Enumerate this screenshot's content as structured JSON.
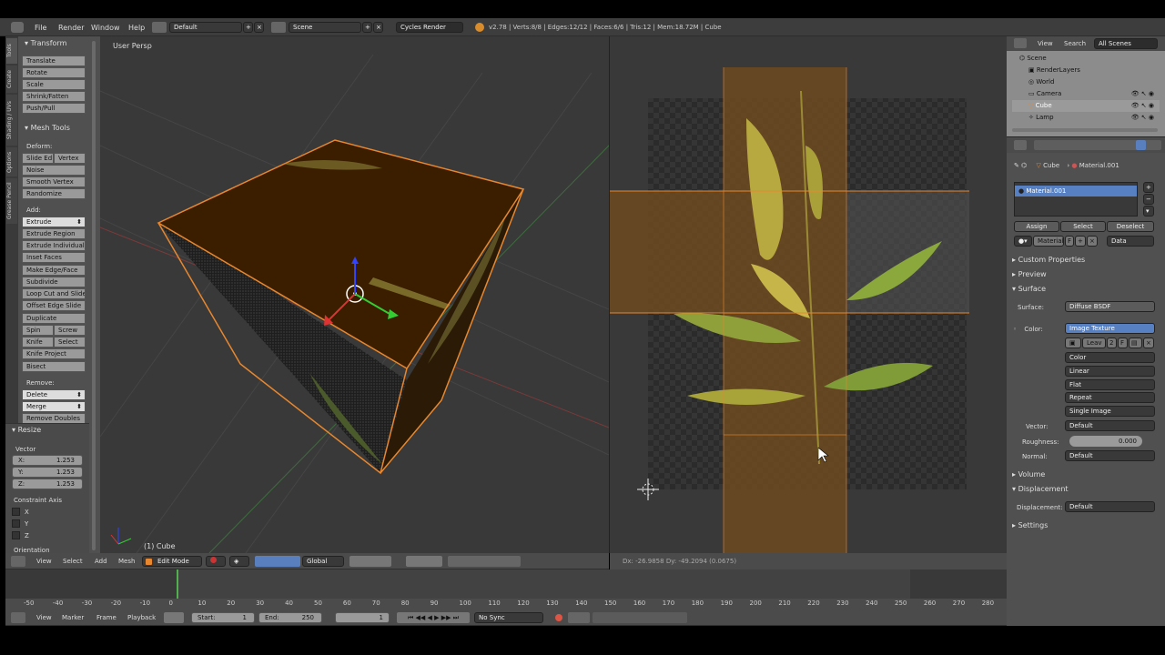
{
  "topbar": {
    "menus": [
      "File",
      "Render",
      "Window",
      "Help"
    ],
    "layout": "Default",
    "scene": "Scene",
    "engine": "Cycles Render",
    "stats": "v2.78 | Verts:8/8 | Edges:12/12 | Faces:6/6 | Tris:12 | Mem:18.72M | Cube"
  },
  "toolshelf": {
    "tabs": [
      "Tools",
      "Create",
      "Shading / UVs",
      "Options",
      "Grease Pencil"
    ],
    "transform_header": "Transform",
    "transform": [
      "Translate",
      "Rotate",
      "Scale",
      "Shrink/Fatten",
      "Push/Pull"
    ],
    "meshtools_header": "Mesh Tools",
    "deform_label": "Deform:",
    "slide_edge": "Slide Ed",
    "vertex": "Vertex",
    "deform": [
      "Noise",
      "Smooth Vertex",
      "Randomize"
    ],
    "add_label": "Add:",
    "extrude": "Extrude",
    "add": [
      "Extrude Region",
      "Extrude Individual",
      "Inset Faces",
      "Make Edge/Face",
      "Subdivide",
      "Loop Cut and Slide",
      "Offset Edge Slide",
      "Duplicate"
    ],
    "spin": "Spin",
    "screw": "Screw",
    "knife": "Knife",
    "select": "Select",
    "knife_project": "Knife Project",
    "bisect": "Bisect",
    "remove_label": "Remove:",
    "delete": "Delete",
    "merge": "Merge",
    "remove_doubles": "Remove Doubles",
    "resize_header": "Resize",
    "vector_label": "Vector",
    "vx": "X:",
    "vy": "Y:",
    "vz": "Z:",
    "vval": "1.253",
    "constraint_label": "Constraint Axis",
    "axes": [
      "X",
      "Y",
      "Z"
    ],
    "orientation_label": "Orientation"
  },
  "viewport": {
    "label": "User Persp",
    "object": "(1) Cube",
    "header": {
      "menus": [
        "View",
        "Select",
        "Add",
        "Mesh"
      ],
      "mode": "Edit Mode",
      "orientation": "Global"
    }
  },
  "uv_editor": {
    "status": "Dx: -26.9858   Dy: -49.2094 (0.0675)"
  },
  "outliner": {
    "menus": [
      "View",
      "Search"
    ],
    "filter": "All Scenes",
    "items": [
      "Scene",
      "RenderLayers",
      "World",
      "Camera",
      "Cube",
      "Lamp"
    ]
  },
  "properties": {
    "crumbs": [
      "Cube",
      "Material.001"
    ],
    "slot": "Material.001",
    "assign": "Assign",
    "select": "Select",
    "deselect": "Deselect",
    "material_name": "Material",
    "f": "F",
    "link": "Data",
    "custom_props": "Custom Properties",
    "preview": "Preview",
    "surface": "Surface",
    "surface_label": "Surface:",
    "surface_val": "Diffuse BSDF",
    "color_label": "Color:",
    "color_val": "Image Texture",
    "image_name": "Leav",
    "image_users": "2",
    "image_f": "F",
    "tex_color": "Color",
    "tex_interp": "Linear",
    "tex_proj": "Flat",
    "tex_ext": "Repeat",
    "tex_source": "Single Image",
    "vector_label": "Vector:",
    "vector_val": "Default",
    "roughness_label": "Roughness:",
    "roughness_val": "0.000",
    "normal_label": "Normal:",
    "normal_val": "Default",
    "volume": "Volume",
    "displacement": "Displacement",
    "disp_label": "Displacement:",
    "disp_val": "Default",
    "settings": "Settings"
  },
  "timeline": {
    "ticks": [
      "-50",
      "-40",
      "-30",
      "-20",
      "-10",
      "0",
      "10",
      "20",
      "30",
      "40",
      "50",
      "60",
      "70",
      "80",
      "90",
      "100",
      "110",
      "120",
      "130",
      "140",
      "150",
      "160",
      "170",
      "180",
      "190",
      "200",
      "210",
      "220",
      "230",
      "240",
      "250",
      "260",
      "270",
      "280"
    ],
    "menus": [
      "View",
      "Marker",
      "Frame",
      "Playback"
    ],
    "start_label": "Start:",
    "start": "1",
    "end_label": "End:",
    "end": "250",
    "current": "1",
    "sync": "No Sync"
  }
}
